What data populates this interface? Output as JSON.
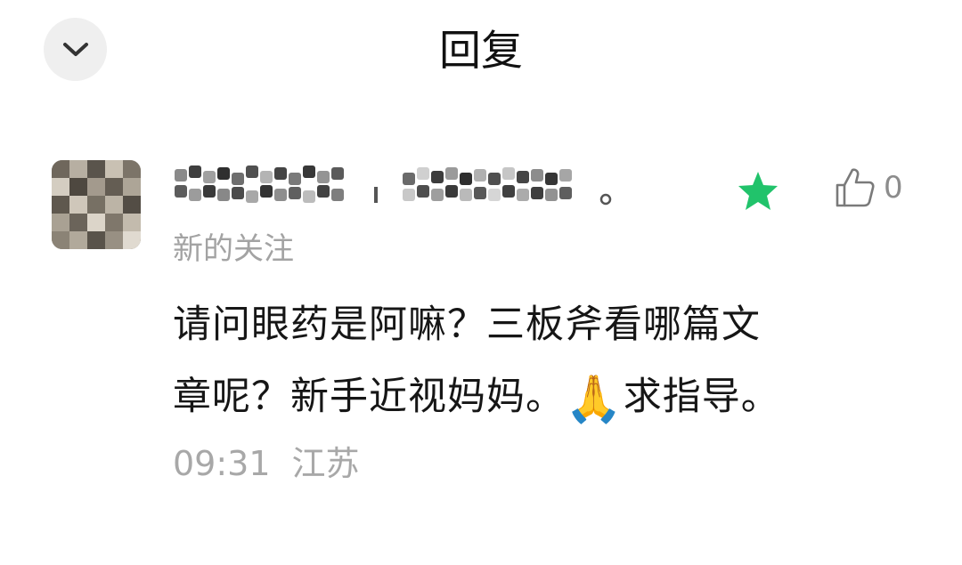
{
  "header": {
    "title": "回复"
  },
  "comment": {
    "tag": "新的关注",
    "text_line1": "请问眼药是阿嘛？三板斧看哪篇文",
    "text_line2_a": "章呢？新手近视妈妈。",
    "emoji": "🙏",
    "text_line2_b": "求指导。",
    "time": "09:31",
    "location": "江苏",
    "like_count": "0"
  },
  "icons": {
    "back": "chevron-down-icon",
    "star": "star-icon",
    "like": "thumbs-up-icon"
  },
  "colors": {
    "star": "#21c36b",
    "text": "#161616",
    "muted": "#a3a3a3",
    "back_bg": "#efefef"
  }
}
